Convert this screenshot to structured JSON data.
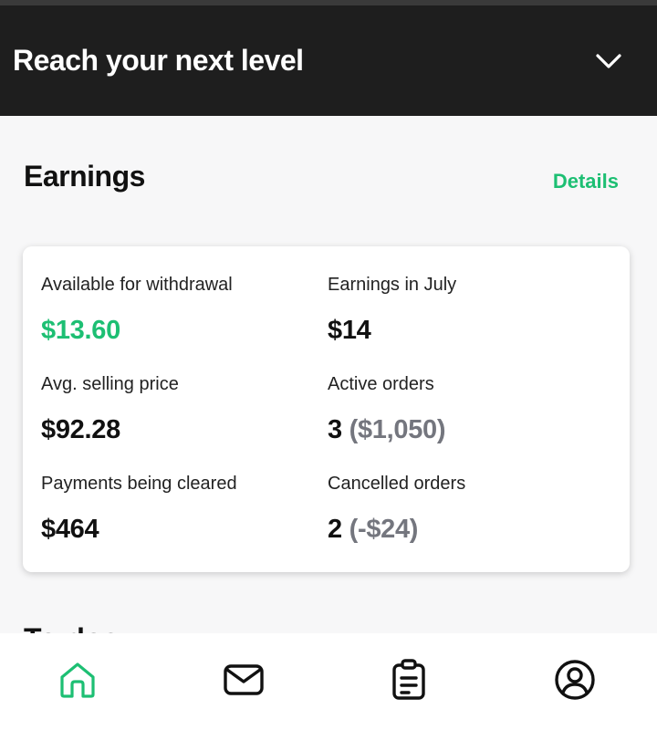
{
  "header": {
    "title": "Reach your next level"
  },
  "earnings": {
    "title": "Earnings",
    "details_label": "Details",
    "stats": {
      "available": {
        "label": "Available for withdrawal",
        "value": "$13.60"
      },
      "month": {
        "label": "Earnings in July",
        "value": "$14"
      },
      "avg_price": {
        "label": "Avg. selling price",
        "value": "$92.28"
      },
      "active": {
        "label": "Active orders",
        "count": "3",
        "amount": "($1,050)"
      },
      "clearing": {
        "label": "Payments being cleared",
        "value": "$464"
      },
      "cancelled": {
        "label": "Cancelled orders",
        "count": "2",
        "amount": "(-$24)"
      }
    }
  },
  "next_section_peek": "To-dos",
  "bottom_nav": {
    "items": [
      {
        "icon": "home-icon",
        "active": true
      },
      {
        "icon": "inbox-icon",
        "active": false
      },
      {
        "icon": "orders-icon",
        "active": false
      },
      {
        "icon": "profile-icon",
        "active": false
      }
    ]
  },
  "colors": {
    "accent": "#1dbf73",
    "header_bg": "#1e1e1e",
    "muted": "#74767e"
  }
}
